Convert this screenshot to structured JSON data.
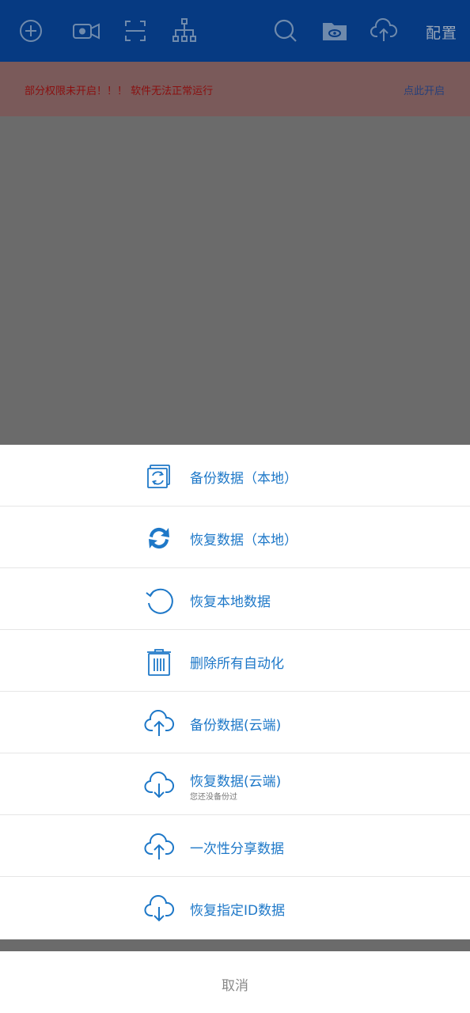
{
  "toolbar": {
    "icons": [
      "add-icon",
      "video-camera-icon",
      "scan-icon",
      "hierarchy-icon",
      "search-icon",
      "folder-eye-icon",
      "cloud-upload-icon"
    ],
    "config_label": "配置"
  },
  "warning": {
    "message": "部分权限未开启！！！ 软件无法正常运行",
    "link": "点此开启"
  },
  "sheet": {
    "items": [
      {
        "label": "备份数据（本地）",
        "icon": "backup-sync-icon"
      },
      {
        "label": "恢复数据（本地）",
        "icon": "refresh-arrows-icon"
      },
      {
        "label": "恢复本地数据",
        "icon": "undo-circle-icon"
      },
      {
        "label": "删除所有自动化",
        "icon": "trash-icon"
      },
      {
        "label": "备份数据(云端)",
        "icon": "cloud-upload-icon"
      },
      {
        "label": "恢复数据(云端)",
        "sublabel": "您还没备份过",
        "icon": "cloud-download-icon"
      },
      {
        "label": "一次性分享数据",
        "icon": "cloud-upload-icon"
      },
      {
        "label": "恢复指定ID数据",
        "icon": "cloud-download-icon"
      }
    ],
    "cancel": "取消"
  },
  "colors": {
    "toolbar_bg": "#063a82",
    "accent": "#1e78c8",
    "warning_text": "#8a1010"
  }
}
